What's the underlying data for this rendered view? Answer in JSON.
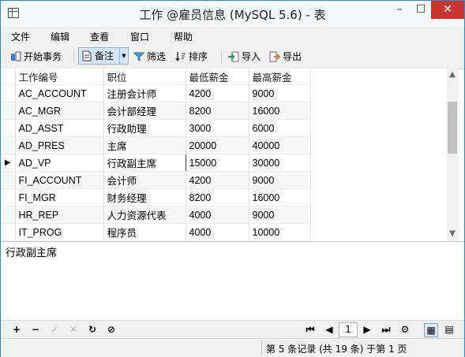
{
  "window": {
    "title": "工作 @雇员信息 (MySQL 5.6) - 表"
  },
  "menu": [
    "文件",
    "编辑",
    "查看",
    "窗口",
    "帮助"
  ],
  "toolbar": {
    "begin_txn": "开始事务",
    "memo": "备注",
    "filter": "筛选",
    "sort": "排序",
    "import": "导入",
    "export": "导出"
  },
  "table": {
    "columns": [
      "工作编号",
      "职位",
      "最低薪金",
      "最高薪金"
    ],
    "rows": [
      [
        "AC_ACCOUNT",
        "注册会计师",
        "4200",
        "9000"
      ],
      [
        "AC_MGR",
        "会计部经理",
        "8200",
        "16000"
      ],
      [
        "AD_ASST",
        "行政助理",
        "3000",
        "6000"
      ],
      [
        "AD_PRES",
        "主席",
        "20000",
        "40000"
      ],
      [
        "AD_VP",
        "行政副主席",
        "15000",
        "30000"
      ],
      [
        "FI_ACCOUNT",
        "会计师",
        "4200",
        "9000"
      ],
      [
        "FI_MGR",
        "财务经理",
        "8200",
        "16000"
      ],
      [
        "HR_REP",
        "人力资源代表",
        "4000",
        "9000"
      ],
      [
        "IT_PROG",
        "程序员",
        "4000",
        "10000"
      ]
    ],
    "current_row": 5
  },
  "memo": {
    "text": "行政副主席"
  },
  "navigation": {
    "page": "1"
  },
  "status": {
    "text": "第 5 条记录 (共 19 条) 于第 1 页"
  },
  "colors": {
    "accent": "#2a8ad4",
    "close": "#c7372f",
    "grid_line": "#e6e6e6"
  },
  "icons": [
    "table-icon",
    "begin-txn-icon",
    "memo-icon",
    "filter-icon",
    "sort-icon",
    "import-icon",
    "export-icon",
    "add-icon",
    "delete-icon",
    "apply-icon",
    "discard-icon",
    "refresh-icon",
    "stop-icon",
    "first-page-icon",
    "prev-page-icon",
    "next-page-icon",
    "last-page-icon",
    "settings-icon",
    "grid-view-icon",
    "form-view-icon"
  ]
}
